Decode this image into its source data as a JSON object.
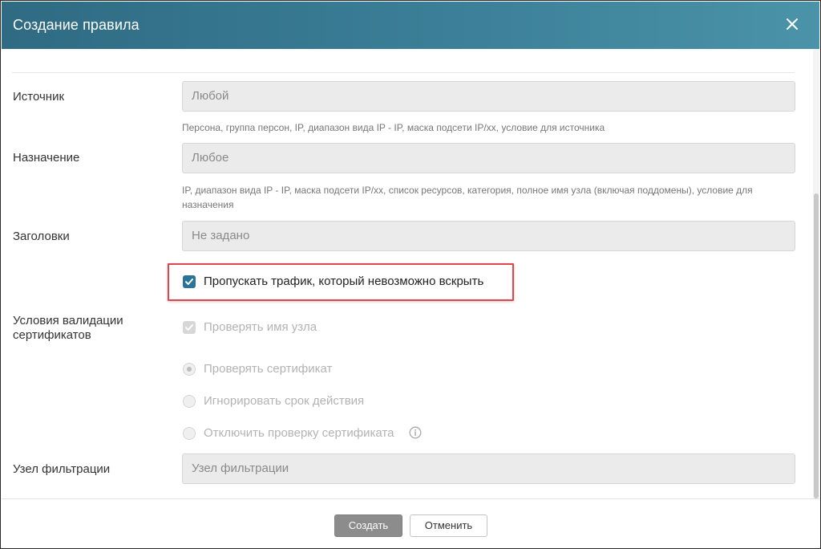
{
  "dialog": {
    "title": "Создание правила",
    "close_icon": "close-icon"
  },
  "form": {
    "source": {
      "label": "Источник",
      "value": "Любой",
      "hint": "Персона, группа персон, IP, диапазон вида IP - IP, маска подсети IP/xx, условие для источника"
    },
    "destination": {
      "label": "Назначение",
      "value": "Любое",
      "hint": "IP, диапазон вида IP - IP, маска подсети IP/xx, список ресурсов, категория, полное имя узла (включая поддомены), условие для назначения"
    },
    "headers": {
      "label": "Заголовки",
      "value": "Не задано"
    },
    "skip_traffic": {
      "label": "Пропускать трафик, который невозможно вскрыть",
      "checked": true
    },
    "cert_validation": {
      "label": "Условия валидации сертификатов",
      "check_host": {
        "label": "Проверять имя узла",
        "checked": true,
        "disabled": true
      },
      "radio_options": [
        {
          "label": "Проверять сертификат",
          "selected": true
        },
        {
          "label": "Игнорировать срок действия",
          "selected": false
        },
        {
          "label": "Отключить проверку сертификата",
          "selected": false,
          "info_icon": "info-icon"
        }
      ]
    },
    "filter_node": {
      "label": "Узел фильтрации",
      "placeholder": "Узел фильтрации"
    }
  },
  "footer": {
    "create_label": "Создать",
    "cancel_label": "Отменить"
  },
  "colors": {
    "header_start": "#2f6b83",
    "header_end": "#4a93a8",
    "checkbox_accent": "#2a7597",
    "highlight_border": "#e0444e"
  }
}
